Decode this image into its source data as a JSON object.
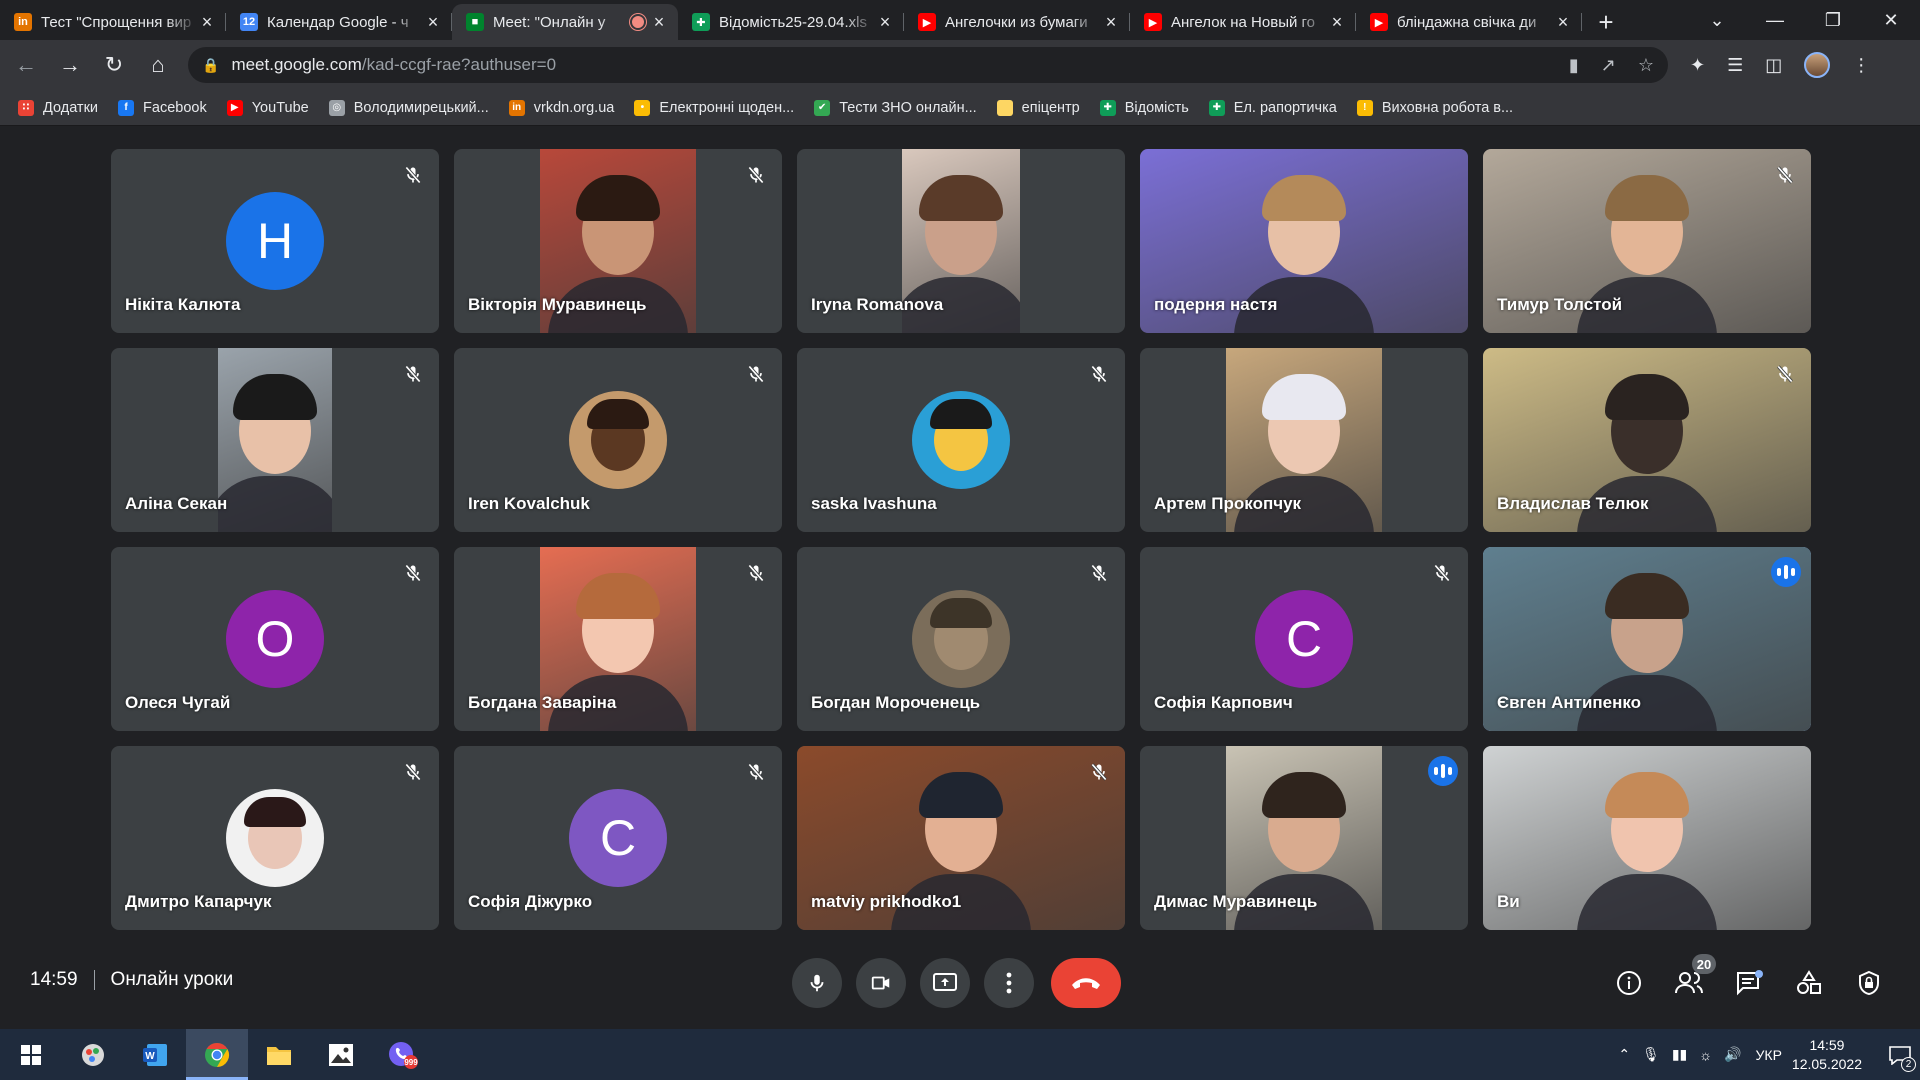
{
  "browser": {
    "tabs": [
      {
        "title": "Тест \"Спрощення вир",
        "favicon": "in",
        "favicon_color": "#e37400",
        "active": false
      },
      {
        "title": "Календар Google - ч",
        "favicon": "12",
        "favicon_color": "#4285f4",
        "active": false
      },
      {
        "title": "Meet: \"Онлайн у",
        "favicon": "meet-icon",
        "favicon_color": "#00832d",
        "active": true,
        "recording": true
      },
      {
        "title": "Відомість25-29.04.xls",
        "favicon": "sheets-icon",
        "favicon_color": "#0f9d58",
        "active": false
      },
      {
        "title": "Ангелочки из бумаги",
        "favicon": "youtube-icon",
        "favicon_color": "#ff0000",
        "active": false
      },
      {
        "title": "Ангелок на Новый го",
        "favicon": "youtube-icon",
        "favicon_color": "#ff0000",
        "active": false
      },
      {
        "title": "бліндажна свічка ди",
        "favicon": "youtube-icon",
        "favicon_color": "#ff0000",
        "active": false
      }
    ],
    "url_host": "meet.google.com",
    "url_path": "/kad-ccgf-rae?authuser=0",
    "bookmarks": [
      {
        "label": "Додатки",
        "icon": "apps-grid-icon",
        "color": "#ea4335"
      },
      {
        "label": "Facebook",
        "icon": "facebook-icon",
        "color": "#1877f2"
      },
      {
        "label": "YouTube",
        "icon": "youtube-icon",
        "color": "#ff0000"
      },
      {
        "label": "Володимирецький...",
        "icon": "globe-icon",
        "color": "#9aa0a6"
      },
      {
        "label": "vrkdn.org.ua",
        "icon": "in-icon",
        "color": "#e37400"
      },
      {
        "label": "Електронні щоден...",
        "icon": "bulb-icon",
        "color": "#fbbc04"
      },
      {
        "label": "Тести ЗНО онлайн...",
        "icon": "zno-icon",
        "color": "#34a853"
      },
      {
        "label": "епіцентр",
        "icon": "bookmark-icon",
        "color": "#fdd663"
      },
      {
        "label": "Відомість",
        "icon": "sheets-icon",
        "color": "#0f9d58"
      },
      {
        "label": "Ел. рапортичка",
        "icon": "sheets-icon",
        "color": "#0f9d58"
      },
      {
        "label": "Виховна робота в...",
        "icon": "warning-icon",
        "color": "#fbbc04"
      }
    ]
  },
  "meet": {
    "participants": [
      {
        "name": "Нікіта Калюта",
        "kind": "initial",
        "initial": "H",
        "color": "#1a73e8",
        "muted": true
      },
      {
        "name": "Вікторія Муравинець",
        "kind": "video",
        "muted": true,
        "bg": "#b8483a",
        "skin": "#c99576",
        "hair": "#2b1a12"
      },
      {
        "name": "Iryna Romanova",
        "kind": "video",
        "muted": false,
        "bg": "#d9c8bd",
        "skin": "#caa08a",
        "hair": "#5a3b29"
      },
      {
        "name": "подерня настя",
        "kind": "video",
        "muted": false,
        "bg": "#7b6fd6",
        "skin": "#e7c0a6",
        "hair": "#b48a5a"
      },
      {
        "name": "Тимур Толстой",
        "kind": "video",
        "muted": true,
        "bg": "#b3a89a",
        "skin": "#e3b596",
        "hair": "#8b6a44"
      },
      {
        "name": "Аліна Секан",
        "kind": "video",
        "muted": true,
        "bg": "#9aa3ab",
        "skin": "#e8c1a8",
        "hair": "#1a1a1a"
      },
      {
        "name": "Iren Kovalchuk",
        "kind": "avatar",
        "muted": true,
        "bg": "#c49a6c",
        "skin": "#5b3822",
        "hair": "#2b1a12"
      },
      {
        "name": "saska Ivashuna",
        "kind": "avatar",
        "muted": true,
        "bg": "#2a9fd6",
        "skin": "#f4c542",
        "hair": "#1a1a1a"
      },
      {
        "name": "Артем Прокопчук",
        "kind": "video",
        "muted": false,
        "bg": "#c7a77c",
        "skin": "#ecc8b2",
        "hair": "#e8e8f0"
      },
      {
        "name": "Владислав Телюк",
        "kind": "video",
        "muted": true,
        "bg": "#cdbb86",
        "skin": "#3a2f2a",
        "hair": "#2a2320"
      },
      {
        "name": "Олеся Чугай",
        "kind": "initial",
        "initial": "O",
        "color": "#8e24aa",
        "muted": true
      },
      {
        "name": "Богдана Заваріна",
        "kind": "video",
        "muted": true,
        "bg": "#e56d52",
        "skin": "#f3c7b0",
        "hair": "#b56a3c"
      },
      {
        "name": "Богдан Мороченець",
        "kind": "avatar",
        "muted": true,
        "bg": "#7b6d5a",
        "skin": "#a08a70",
        "hair": "#3d3428"
      },
      {
        "name": "Софія Карпович",
        "kind": "initial",
        "initial": "C",
        "color": "#8e24aa",
        "muted": true
      },
      {
        "name": "Євген Антипенко",
        "kind": "video",
        "muted": false,
        "speaking": true,
        "bg": "#5f7f8f",
        "skin": "#c8a28b",
        "hair": "#3a2c22"
      },
      {
        "name": "Дмитро Капарчук",
        "kind": "avatar",
        "muted": true,
        "bg": "#f1f1f1",
        "skin": "#e9c6b7",
        "hair": "#2a1818"
      },
      {
        "name": "Софія Діжурко",
        "kind": "initial",
        "initial": "C",
        "color": "#7e57c2",
        "muted": true
      },
      {
        "name": "matviy prikhodko1",
        "kind": "video",
        "muted": true,
        "bg": "#8b4a2b",
        "skin": "#e3b093",
        "hair": "#1f2530"
      },
      {
        "name": "Димас Муравинець",
        "kind": "video",
        "muted": false,
        "speaking_icon": true,
        "bg": "#c9c3b4",
        "skin": "#d9ab8f",
        "hair": "#2f241d"
      },
      {
        "name": "Ви",
        "kind": "video",
        "muted": false,
        "bg": "#cfd2d3",
        "skin": "#f0c4ae",
        "hair": "#c58a58"
      }
    ],
    "time": "14:59",
    "meeting_title": "Онлайн уроки",
    "people_count": "20"
  },
  "taskbar": {
    "apps": [
      "start-icon",
      "control-panel-icon",
      "word-icon",
      "chrome-icon",
      "file-explorer-icon",
      "photos-icon",
      "viber-icon"
    ],
    "viber_badge": "999",
    "language": "УКР",
    "clock_time": "14:59",
    "clock_date": "12.05.2022",
    "notifications": "2"
  }
}
